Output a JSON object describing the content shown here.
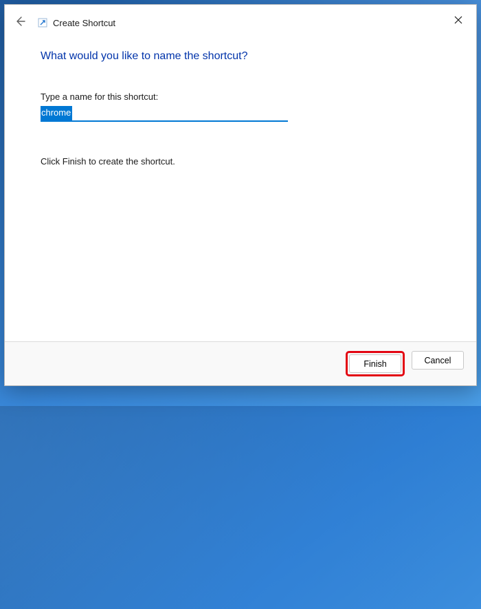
{
  "dialog": {
    "title": "Create Shortcut",
    "heading": "What would you like to name the shortcut?",
    "field_label": "Type a name for this shortcut:",
    "input_value": "chrome",
    "instruction": "Click Finish to create the shortcut.",
    "buttons": {
      "finish": "Finish",
      "cancel": "Cancel"
    }
  }
}
